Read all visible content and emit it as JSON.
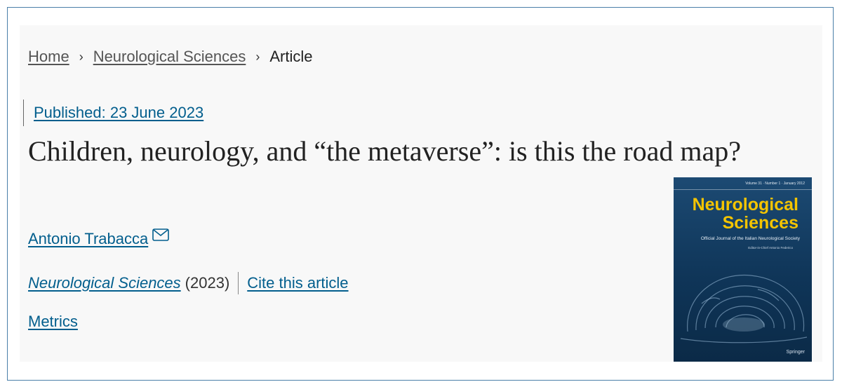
{
  "breadcrumb": {
    "home": "Home",
    "journal": "Neurological Sciences",
    "current": "Article",
    "separator": "›"
  },
  "article": {
    "published": "Published: 23 June 2023",
    "title": "Children, neurology, and “the metaverse”: is this the road map?",
    "author": "Antonio Trabacca",
    "journal": "Neurological Sciences",
    "year": "(2023)",
    "cite": "Cite this article",
    "metrics": "Metrics"
  },
  "cover": {
    "issue_line": "Volume 31 · Number 1 · January 2012",
    "title_line1": "Neurological",
    "title_line2": "Sciences",
    "subtitle": "Official Journal of the Italian Neurological Society",
    "editor": "Editor-in-Chief Antonio Federico",
    "publisher": "Springer"
  },
  "icons": {
    "chevron": "chevron-right-icon",
    "mail": "mail-icon"
  },
  "colors": {
    "link": "#025e8d",
    "cover_bg": "#0f3558",
    "cover_title": "#f4c400"
  }
}
